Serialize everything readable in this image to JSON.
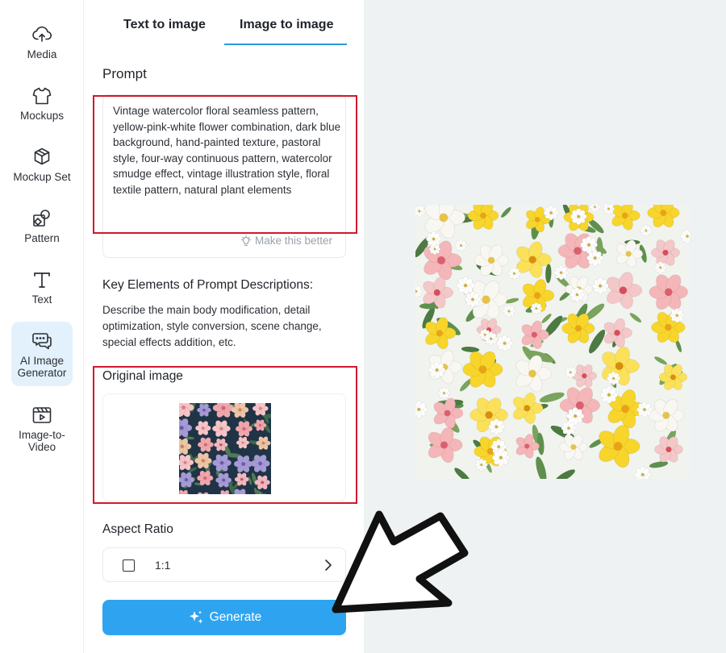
{
  "sidebar": {
    "items": [
      {
        "label": "Media",
        "icon": "cloud-upload-icon"
      },
      {
        "label": "Mockups",
        "icon": "tshirt-icon"
      },
      {
        "label": "Mockup Set",
        "icon": "cube-icon"
      },
      {
        "label": "Pattern",
        "icon": "pattern-icon"
      },
      {
        "label": "Text",
        "icon": "text-icon"
      },
      {
        "label": "AI Image Generator",
        "icon": "chat-bubbles-icon",
        "active": true
      },
      {
        "label": "Image-to-Video",
        "icon": "video-icon"
      }
    ]
  },
  "tabs": [
    {
      "label": "Text to image",
      "active": false
    },
    {
      "label": "Image to image",
      "active": true
    }
  ],
  "prompt": {
    "title": "Prompt",
    "text": "Vintage watercolor floral seamless pattern, yellow-pink-white flower combination, dark blue background, hand-painted texture, pastoral style, four-way continuous pattern, watercolor smudge effect, vintage illustration style, floral textile pattern, natural plant elements",
    "improve_label": "Make this better",
    "improve_icon": "lightbulb-icon"
  },
  "key_elements": {
    "title": "Key Elements of Prompt Descriptions:",
    "description": "Describe the main body modification, detail optimization, style conversion, scene change, special effects addition, etc."
  },
  "original_image": {
    "title": "Original image"
  },
  "aspect_ratio": {
    "title": "Aspect Ratio",
    "value": "1:1",
    "chevron_icon": "chevron-right-icon"
  },
  "generate": {
    "label": "Generate",
    "icon": "sparkle-icon"
  },
  "colors": {
    "accent": "#2ea4f0",
    "tab_underline": "#2a9ad8",
    "active_rail_bg": "#e3f1fc",
    "highlight": "#d0192b",
    "canvas_bg": "#eef2f3"
  }
}
